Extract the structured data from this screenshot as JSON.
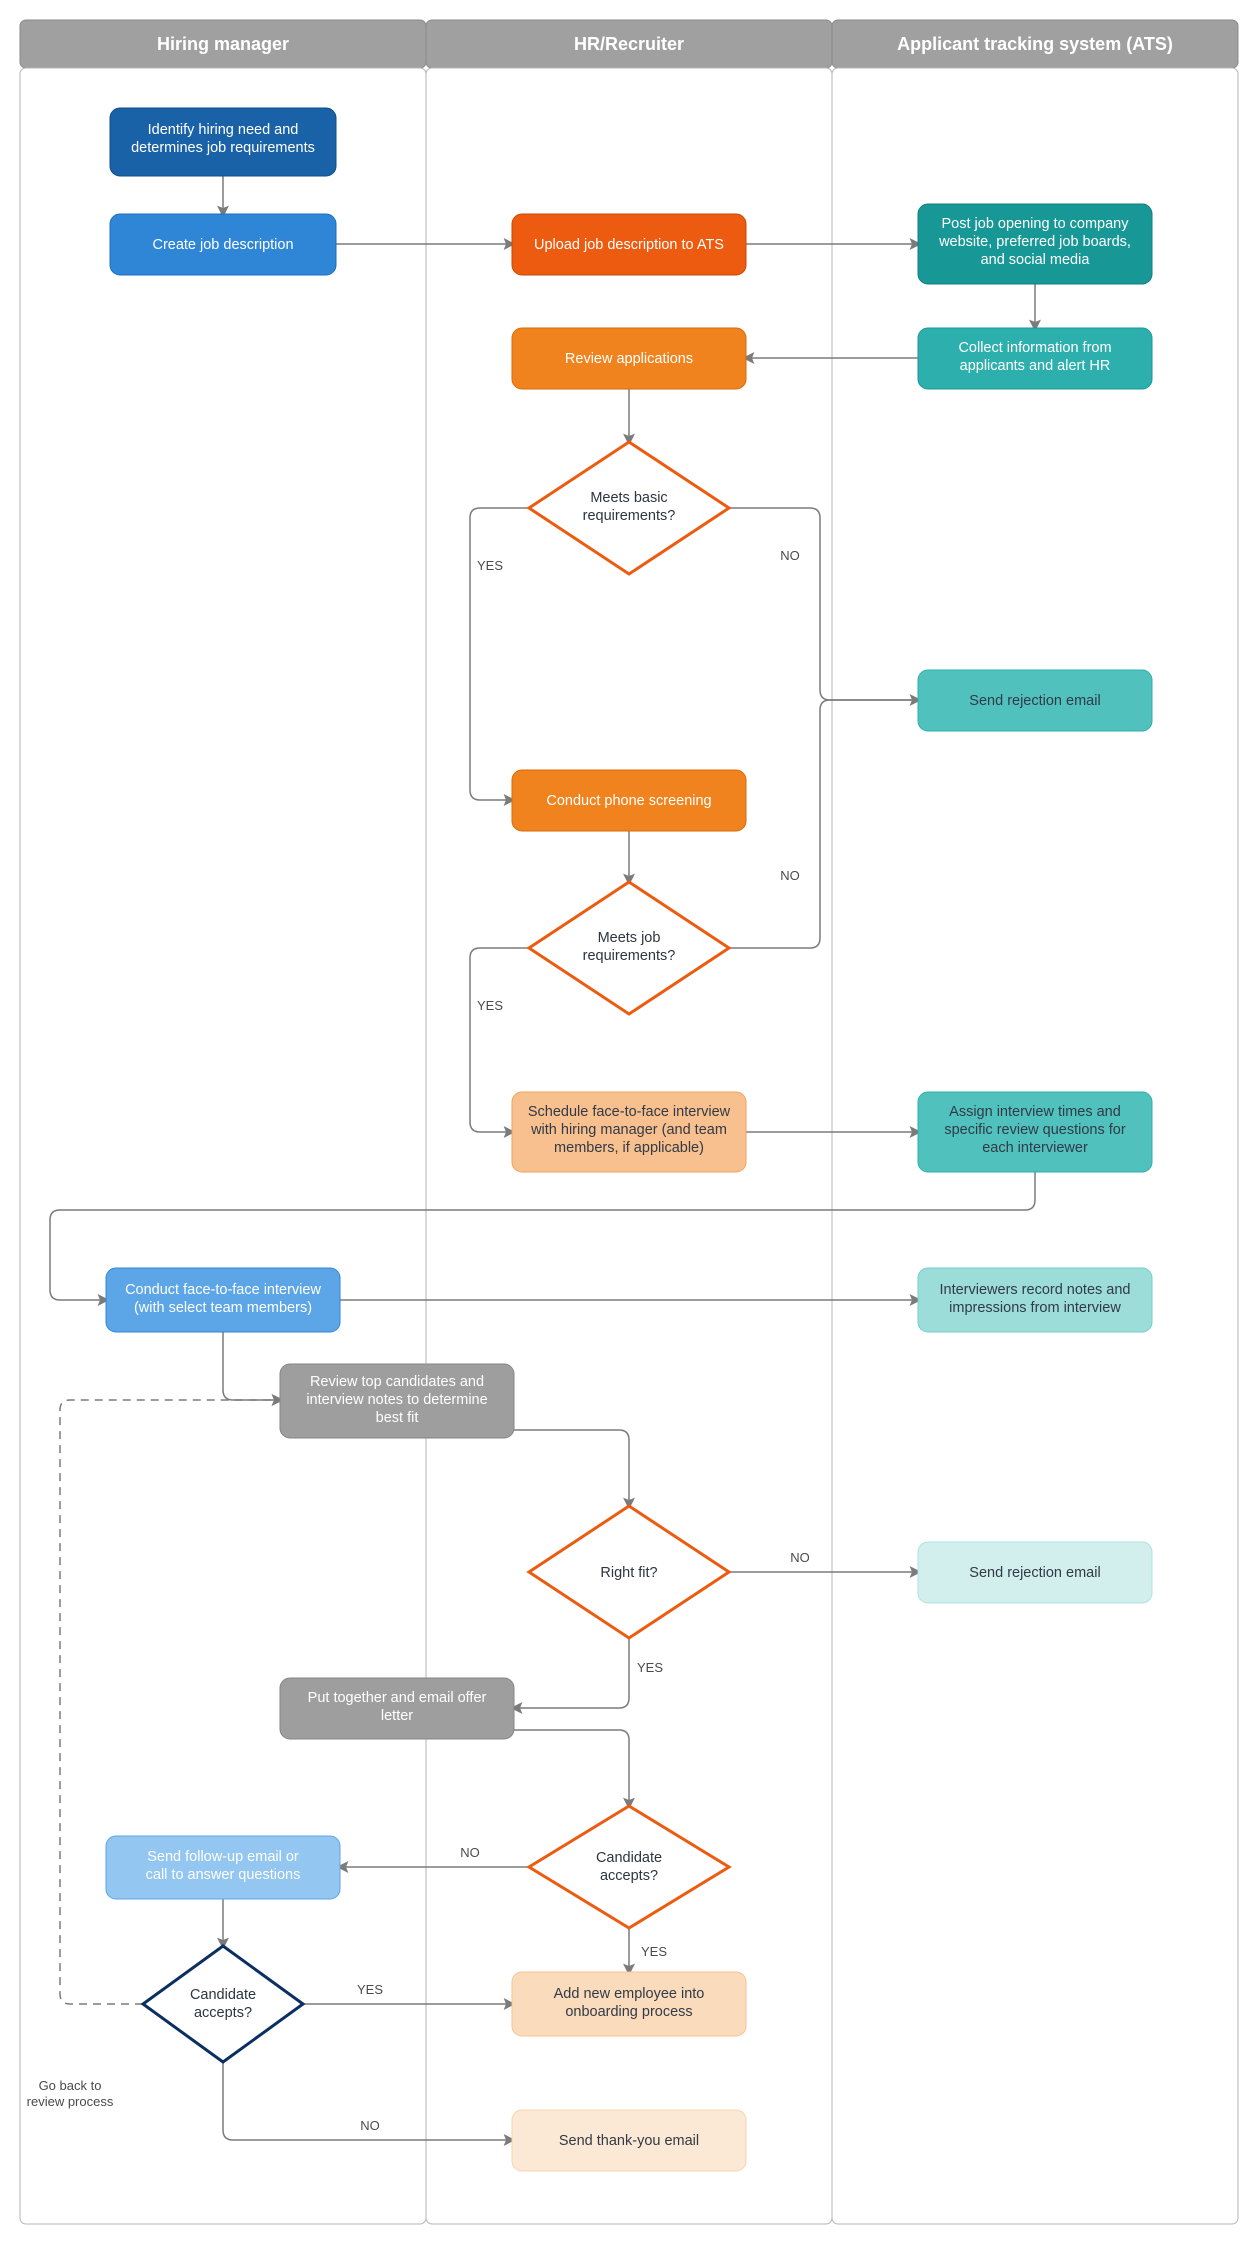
{
  "lanes": {
    "hm": "Hiring manager",
    "hr": "HR/Recruiter",
    "ats": "Applicant tracking system (ATS)"
  },
  "nodes": {
    "hm1": "Identify hiring need and determines job requirements",
    "hm2": "Create job description",
    "hr1": "Upload job description to ATS",
    "ats1": "Post job opening to company website, preferred job boards, and social media",
    "ats2": "Collect information from applicants and alert HR",
    "hr2": "Review applications",
    "d1": "Meets basic requirements?",
    "ats3": "Send rejection email",
    "hr3": "Conduct phone screening",
    "d2": "Meets job requirements?",
    "hr4": "Schedule face-to-face interview with hiring manager (and team members, if applicable)",
    "ats4": "Assign interview times and specific review questions for each interviewer",
    "hm3": "Conduct face-to-face interview (with select team members)",
    "ats5": "Interviewers record notes and impressions from interview",
    "hm4": "Review top candidates and interview notes to determine best fit",
    "d3": "Right fit?",
    "ats6": "Send rejection email",
    "hm5": "Put together and email offer letter",
    "d4": "Candidate accepts?",
    "hm6": "Send follow-up email or call to answer questions",
    "d5": "Candidate accepts?",
    "hr5": "Add new employee into onboarding process",
    "hr6": "Send thank-you email",
    "goBack": "Go back to review process"
  },
  "labels": {
    "yes": "YES",
    "no": "NO"
  },
  "colors": {
    "darkBlue": "#1a62a8",
    "blue": "#2f86d6",
    "lightBlue": "#5ca6e7",
    "orangeDark": "#ec5b0f",
    "orange": "#f1831f",
    "orangeLight": "#f8c08f",
    "orangeLighter": "#fadcbd",
    "tealDark": "#179896",
    "teal": "#2db0ad",
    "tealMed": "#51c1be",
    "tealLight": "#9cddda",
    "tealLighter": "#d2eeed",
    "grey": "#9e9e9e",
    "diamondNavy": "#0b2f60",
    "diamondOrange": "#ec5b0f"
  }
}
